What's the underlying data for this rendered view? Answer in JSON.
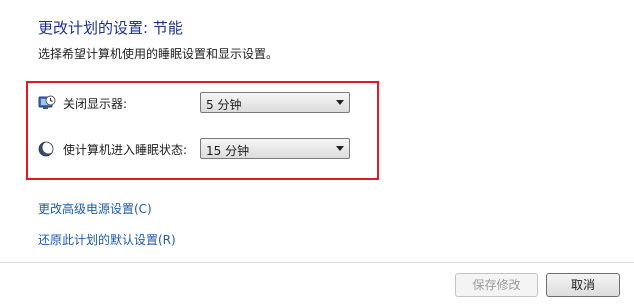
{
  "header": {
    "title": "更改计划的设置: 节能",
    "description": "选择希望计算机使用的睡眠设置和显示设置。"
  },
  "settings": {
    "display_off": {
      "label": "关闭显示器:",
      "value": "5 分钟",
      "icon": "monitor-clock-icon"
    },
    "sleep": {
      "label": "使计算机进入睡眠状态:",
      "value": "15 分钟",
      "icon": "moon-icon"
    }
  },
  "links": {
    "advanced": "更改高级电源设置(C)",
    "restore": "还原此计划的默认设置(R)"
  },
  "buttons": {
    "save": "保存修改",
    "cancel": "取消"
  },
  "colors": {
    "title": "#1e3287",
    "link": "#1e5aa8",
    "highlight_border": "#e01b24"
  }
}
